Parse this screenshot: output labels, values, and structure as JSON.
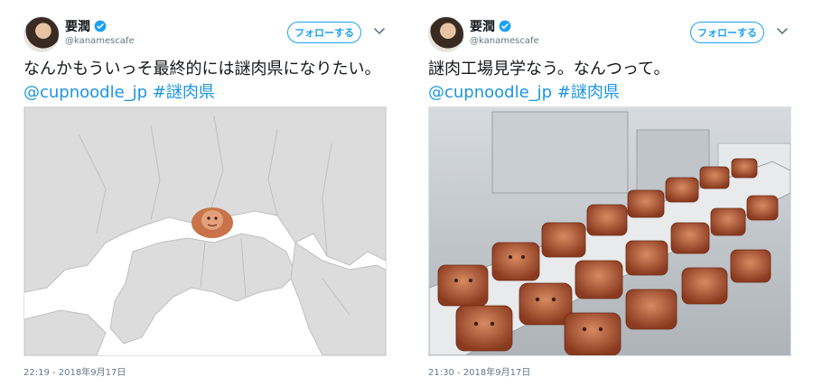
{
  "tweets": [
    {
      "display_name": "要潤",
      "handle": "@kanamescafe",
      "follow_label": "フォローする",
      "text_plain": "なんかもういっそ最終的には謎肉県になりたい。",
      "mention": "@cupnoodle_jp",
      "hashtag": "#謎肉県",
      "timestamp": "22:19 - 2018年9月17日",
      "media": "map-image",
      "icons": [
        "verified-badge-icon",
        "chevron-down-icon"
      ]
    },
    {
      "display_name": "要潤",
      "handle": "@kanamescafe",
      "follow_label": "フォローする",
      "text_plain": "謎肉工場見学なう。なんつって。",
      "mention": "@cupnoodle_jp",
      "hashtag": "#謎肉県",
      "timestamp": "21:30 - 2018年9月17日",
      "media": "factory-conveyor-image",
      "icons": [
        "verified-badge-icon",
        "chevron-down-icon"
      ]
    }
  ],
  "colors": {
    "brand_blue": "#1da1f2",
    "link": "#1b95e0",
    "muted": "#657786"
  }
}
